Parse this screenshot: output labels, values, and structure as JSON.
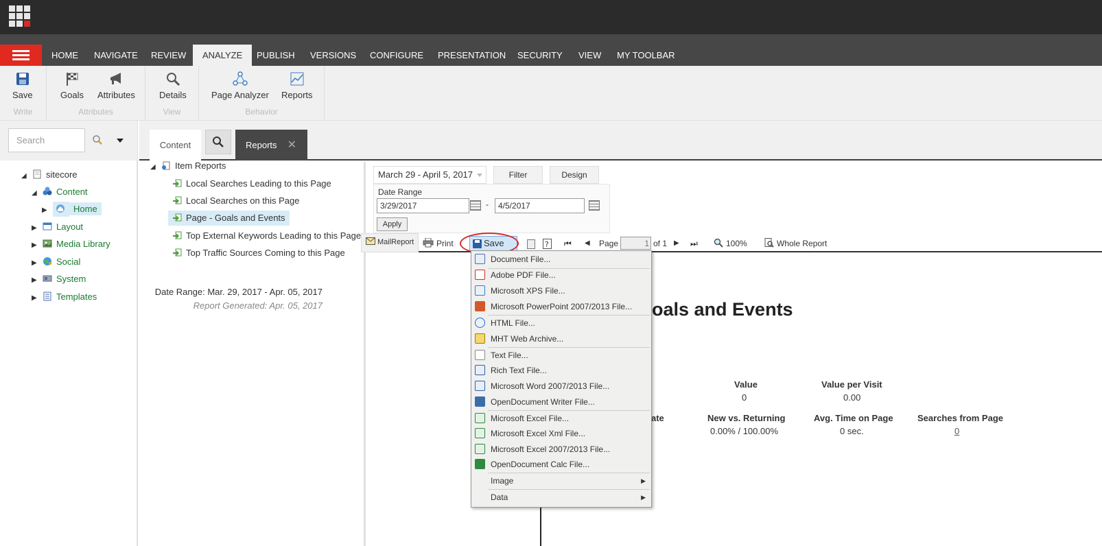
{
  "ribbon_tabs": [
    "HOME",
    "NAVIGATE",
    "REVIEW",
    "ANALYZE",
    "PUBLISH",
    "VERSIONS",
    "CONFIGURE",
    "PRESENTATION",
    "SECURITY",
    "VIEW",
    "MY TOOLBAR"
  ],
  "active_tab": "ANALYZE",
  "ribbon": {
    "write": {
      "label": "Write",
      "save": "Save"
    },
    "attributes": {
      "label": "Attributes",
      "goals": "Goals",
      "attributes": "Attributes"
    },
    "view": {
      "label": "View",
      "details": "Details"
    },
    "behavior": {
      "label": "Behavior",
      "page_analyzer": "Page Analyzer",
      "reports": "Reports"
    }
  },
  "search": {
    "placeholder": "Search"
  },
  "content_tree": [
    {
      "label": "sitecore",
      "icon": "document-icon"
    },
    {
      "label": "Content",
      "icon": "content-icon"
    },
    {
      "label": "Home",
      "icon": "home-icon"
    },
    {
      "label": "Layout",
      "icon": "layout-icon"
    },
    {
      "label": "Media Library",
      "icon": "media-icon"
    },
    {
      "label": "Social",
      "icon": "globe-icon"
    },
    {
      "label": "System",
      "icon": "system-icon"
    },
    {
      "label": "Templates",
      "icon": "templates-icon"
    }
  ],
  "editor_tabs": {
    "content": "Content",
    "reports": "Reports",
    "close": "✕"
  },
  "reports_tree": {
    "root": "Item Reports",
    "items": [
      "Local Searches Leading to this Page",
      "Local Searches on this Page",
      "Page - Goals and Events",
      "Top External Keywords Leading to this Page",
      "Top Traffic Sources Coming to this Page"
    ]
  },
  "viewer": {
    "date_select": "March 29 - April 5, 2017",
    "filter": "Filter",
    "design": "Design",
    "date_range_label": "Date Range",
    "from": "3/29/2017",
    "dash": "-",
    "to": "4/5/2017",
    "apply": "Apply",
    "toolbar": {
      "mailreport": "MailReport",
      "print": "Print",
      "save": "Save",
      "page_label": "Page",
      "page_value": "1",
      "of_pages": "of 1",
      "zoom": "100%",
      "whole_report": "Whole Report"
    }
  },
  "save_menu": [
    {
      "label": "Document File...",
      "color": "#4a6fb0"
    },
    {
      "label": "Adobe PDF File...",
      "color": "#c9302c"
    },
    {
      "label": "Microsoft XPS File...",
      "color": "#3b7ec4"
    },
    {
      "label": "Microsoft PowerPoint 2007/2013 File...",
      "color": "#d2592a"
    },
    {
      "label": "HTML File...",
      "color": "#2a6ec4"
    },
    {
      "label": "MHT Web Archive...",
      "color": "#d4a017"
    },
    {
      "label": "Text File...",
      "color": "#8a8a8a"
    },
    {
      "label": "Rich Text File...",
      "color": "#2f5fa8"
    },
    {
      "label": "Microsoft Word 2007/2013 File...",
      "color": "#2f5fa8"
    },
    {
      "label": "OpenDocument Writer File...",
      "color": "#3b6ea8"
    },
    {
      "label": "Microsoft Excel File...",
      "color": "#2e8b3e"
    },
    {
      "label": "Microsoft Excel Xml File...",
      "color": "#2e8b3e"
    },
    {
      "label": "Microsoft Excel 2007/2013 File...",
      "color": "#2e8b3e"
    },
    {
      "label": "OpenDocument Calc File...",
      "color": "#2e8b3e"
    },
    {
      "label": "Image",
      "color": "",
      "submenu": true
    },
    {
      "label": "Data",
      "color": "",
      "submenu": true
    }
  ],
  "report": {
    "date_range": "Date Range: Mar. 29, 2017 - Apr. 05, 2017",
    "generated": "Report Generated: Apr. 05, 2017",
    "title": "oals and Events",
    "row1": [
      {
        "header": "Value",
        "value": "0"
      },
      {
        "header": "Value per Visit",
        "value": "0.00"
      }
    ],
    "row2": [
      {
        "header": "ate",
        "value": ""
      },
      {
        "header": "New vs. Returning",
        "value": "0.00% / 100.00%"
      },
      {
        "header": "Avg. Time on Page",
        "value": "0 sec."
      },
      {
        "header": "Searches from Page",
        "value": "0"
      }
    ]
  }
}
